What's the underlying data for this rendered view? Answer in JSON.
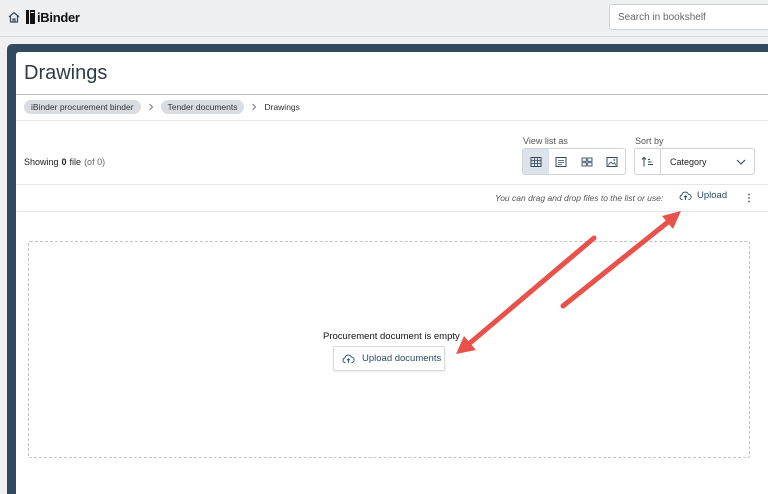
{
  "header": {
    "logo_text": "iBinder",
    "search_placeholder": "Search in bookshelf"
  },
  "page": {
    "title": "Drawings"
  },
  "breadcrumb": {
    "items": [
      "iBinder procurement binder",
      "Tender documents"
    ],
    "current": "Drawings"
  },
  "listing": {
    "showing_prefix": "Showing",
    "count": "0",
    "file_word": "file",
    "total": "(of 0)"
  },
  "view": {
    "label": "View list as",
    "options": [
      "table-view",
      "list-view",
      "grid-view",
      "image-view"
    ],
    "selected": "table-view"
  },
  "sort": {
    "label": "Sort by",
    "value": "Category"
  },
  "toolbar": {
    "drag_hint": "You can drag and drop files to the list or use:",
    "upload_label": "Upload"
  },
  "empty_state": {
    "message": "Procurement document is empty",
    "button_label": "Upload documents"
  },
  "colors": {
    "frame": "#34495e",
    "link": "#2a4a6b",
    "annotation_arrow": "#e8524a"
  }
}
